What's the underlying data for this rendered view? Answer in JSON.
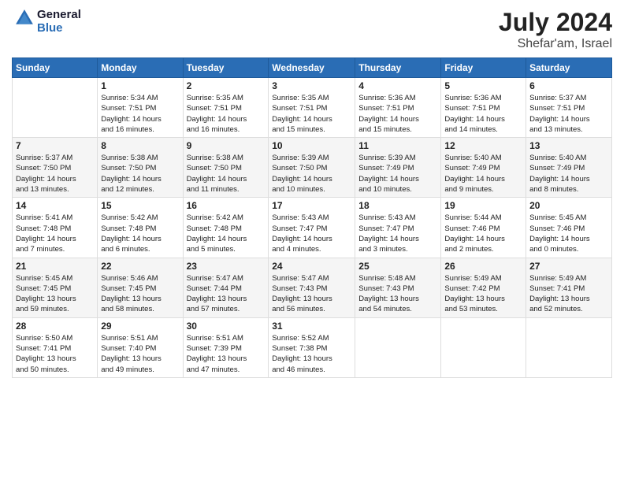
{
  "logo": {
    "line1": "General",
    "line2": "Blue"
  },
  "header": {
    "month_year": "July 2024",
    "location": "Shefar'am, Israel"
  },
  "weekdays": [
    "Sunday",
    "Monday",
    "Tuesday",
    "Wednesday",
    "Thursday",
    "Friday",
    "Saturday"
  ],
  "weeks": [
    [
      {
        "day": "",
        "info": ""
      },
      {
        "day": "1",
        "info": "Sunrise: 5:34 AM\nSunset: 7:51 PM\nDaylight: 14 hours\nand 16 minutes."
      },
      {
        "day": "2",
        "info": "Sunrise: 5:35 AM\nSunset: 7:51 PM\nDaylight: 14 hours\nand 16 minutes."
      },
      {
        "day": "3",
        "info": "Sunrise: 5:35 AM\nSunset: 7:51 PM\nDaylight: 14 hours\nand 15 minutes."
      },
      {
        "day": "4",
        "info": "Sunrise: 5:36 AM\nSunset: 7:51 PM\nDaylight: 14 hours\nand 15 minutes."
      },
      {
        "day": "5",
        "info": "Sunrise: 5:36 AM\nSunset: 7:51 PM\nDaylight: 14 hours\nand 14 minutes."
      },
      {
        "day": "6",
        "info": "Sunrise: 5:37 AM\nSunset: 7:51 PM\nDaylight: 14 hours\nand 13 minutes."
      }
    ],
    [
      {
        "day": "7",
        "info": "Sunrise: 5:37 AM\nSunset: 7:50 PM\nDaylight: 14 hours\nand 13 minutes."
      },
      {
        "day": "8",
        "info": "Sunrise: 5:38 AM\nSunset: 7:50 PM\nDaylight: 14 hours\nand 12 minutes."
      },
      {
        "day": "9",
        "info": "Sunrise: 5:38 AM\nSunset: 7:50 PM\nDaylight: 14 hours\nand 11 minutes."
      },
      {
        "day": "10",
        "info": "Sunrise: 5:39 AM\nSunset: 7:50 PM\nDaylight: 14 hours\nand 10 minutes."
      },
      {
        "day": "11",
        "info": "Sunrise: 5:39 AM\nSunset: 7:49 PM\nDaylight: 14 hours\nand 10 minutes."
      },
      {
        "day": "12",
        "info": "Sunrise: 5:40 AM\nSunset: 7:49 PM\nDaylight: 14 hours\nand 9 minutes."
      },
      {
        "day": "13",
        "info": "Sunrise: 5:40 AM\nSunset: 7:49 PM\nDaylight: 14 hours\nand 8 minutes."
      }
    ],
    [
      {
        "day": "14",
        "info": "Sunrise: 5:41 AM\nSunset: 7:48 PM\nDaylight: 14 hours\nand 7 minutes."
      },
      {
        "day": "15",
        "info": "Sunrise: 5:42 AM\nSunset: 7:48 PM\nDaylight: 14 hours\nand 6 minutes."
      },
      {
        "day": "16",
        "info": "Sunrise: 5:42 AM\nSunset: 7:48 PM\nDaylight: 14 hours\nand 5 minutes."
      },
      {
        "day": "17",
        "info": "Sunrise: 5:43 AM\nSunset: 7:47 PM\nDaylight: 14 hours\nand 4 minutes."
      },
      {
        "day": "18",
        "info": "Sunrise: 5:43 AM\nSunset: 7:47 PM\nDaylight: 14 hours\nand 3 minutes."
      },
      {
        "day": "19",
        "info": "Sunrise: 5:44 AM\nSunset: 7:46 PM\nDaylight: 14 hours\nand 2 minutes."
      },
      {
        "day": "20",
        "info": "Sunrise: 5:45 AM\nSunset: 7:46 PM\nDaylight: 14 hours\nand 0 minutes."
      }
    ],
    [
      {
        "day": "21",
        "info": "Sunrise: 5:45 AM\nSunset: 7:45 PM\nDaylight: 13 hours\nand 59 minutes."
      },
      {
        "day": "22",
        "info": "Sunrise: 5:46 AM\nSunset: 7:45 PM\nDaylight: 13 hours\nand 58 minutes."
      },
      {
        "day": "23",
        "info": "Sunrise: 5:47 AM\nSunset: 7:44 PM\nDaylight: 13 hours\nand 57 minutes."
      },
      {
        "day": "24",
        "info": "Sunrise: 5:47 AM\nSunset: 7:43 PM\nDaylight: 13 hours\nand 56 minutes."
      },
      {
        "day": "25",
        "info": "Sunrise: 5:48 AM\nSunset: 7:43 PM\nDaylight: 13 hours\nand 54 minutes."
      },
      {
        "day": "26",
        "info": "Sunrise: 5:49 AM\nSunset: 7:42 PM\nDaylight: 13 hours\nand 53 minutes."
      },
      {
        "day": "27",
        "info": "Sunrise: 5:49 AM\nSunset: 7:41 PM\nDaylight: 13 hours\nand 52 minutes."
      }
    ],
    [
      {
        "day": "28",
        "info": "Sunrise: 5:50 AM\nSunset: 7:41 PM\nDaylight: 13 hours\nand 50 minutes."
      },
      {
        "day": "29",
        "info": "Sunrise: 5:51 AM\nSunset: 7:40 PM\nDaylight: 13 hours\nand 49 minutes."
      },
      {
        "day": "30",
        "info": "Sunrise: 5:51 AM\nSunset: 7:39 PM\nDaylight: 13 hours\nand 47 minutes."
      },
      {
        "day": "31",
        "info": "Sunrise: 5:52 AM\nSunset: 7:38 PM\nDaylight: 13 hours\nand 46 minutes."
      },
      {
        "day": "",
        "info": ""
      },
      {
        "day": "",
        "info": ""
      },
      {
        "day": "",
        "info": ""
      }
    ]
  ]
}
